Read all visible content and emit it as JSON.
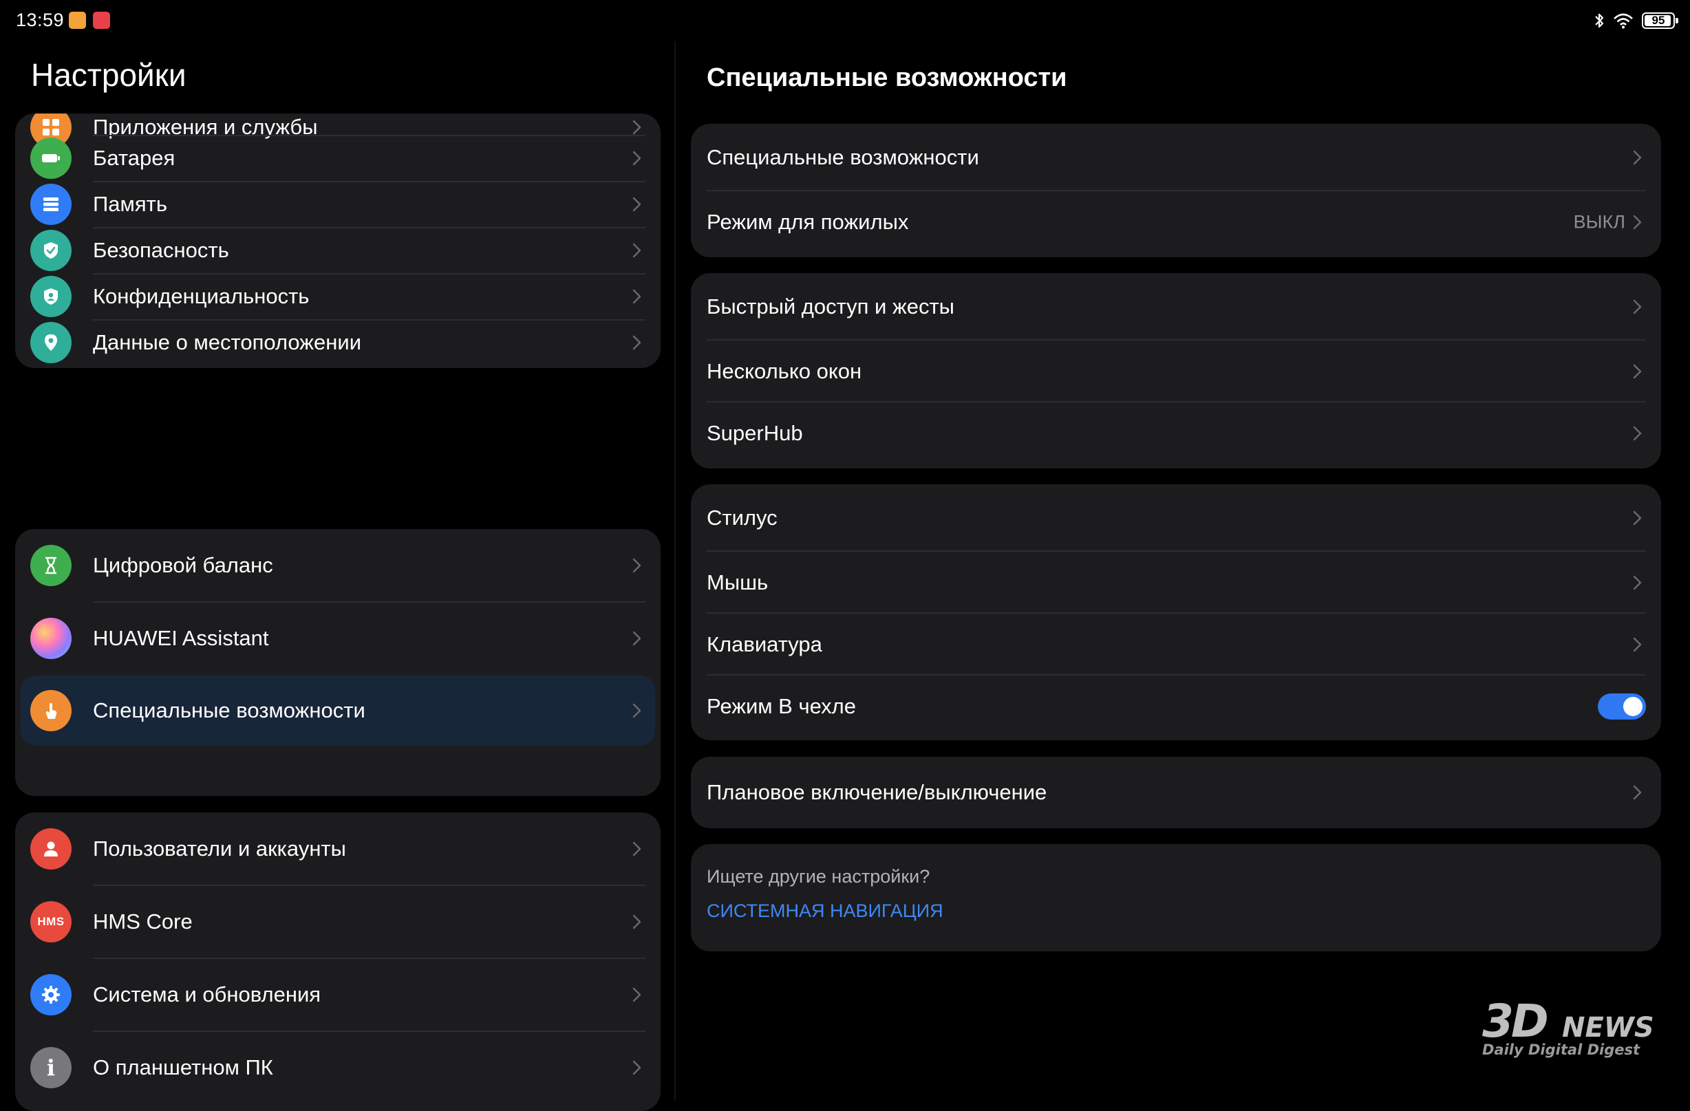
{
  "status_bar": {
    "time": "13:59",
    "battery_level": "95",
    "icons": [
      "notification-app-icon",
      "notification-app-icon",
      "bluetooth-icon",
      "wifi-icon",
      "battery-icon"
    ]
  },
  "left": {
    "title": "Настройки",
    "groups": [
      {
        "items": [
          {
            "label": "Приложения и службы",
            "icon": "apps-icon",
            "color": "#f08c34",
            "partially_visible": true
          },
          {
            "label": "Батарея",
            "icon": "battery-icon",
            "color": "#3fae4e"
          },
          {
            "label": "Память",
            "icon": "storage-icon",
            "color": "#2f7cf6"
          },
          {
            "label": "Безопасность",
            "icon": "shield-check-icon",
            "color": "#2fae9a"
          },
          {
            "label": "Конфиденциальность",
            "icon": "privacy-shield-icon",
            "color": "#2fae9a"
          },
          {
            "label": "Данные о местоположении",
            "icon": "location-pin-icon",
            "color": "#2fae9a"
          }
        ]
      },
      {
        "items": [
          {
            "label": "Цифровой баланс",
            "icon": "hourglass-icon",
            "color": "#3fae4e"
          },
          {
            "label": "HUAWEI Assistant",
            "icon": "assistant-orb-icon",
            "color": "#c46af0"
          },
          {
            "label": "Специальные возможности",
            "icon": "accessibility-hand-icon",
            "color": "#f08c34",
            "selected": true
          }
        ]
      },
      {
        "items": [
          {
            "label": "Пользователи и аккаунты",
            "icon": "user-icon",
            "color": "#e84a3d"
          },
          {
            "label": "HMS Core",
            "icon": "hms-icon",
            "color": "#e84a3d",
            "icon_text": "HMS"
          },
          {
            "label": "Система и обновления",
            "icon": "gear-icon",
            "color": "#2f7cf6"
          },
          {
            "label": "О планшетном ПК",
            "icon": "info-icon",
            "color": "#77777c",
            "icon_text": "i"
          }
        ]
      }
    ]
  },
  "right": {
    "title": "Специальные возможности",
    "groups": [
      {
        "items": [
          {
            "label": "Специальные возможности"
          },
          {
            "label": "Режим для пожилых",
            "value": "ВЫКЛ"
          }
        ]
      },
      {
        "items": [
          {
            "label": "Быстрый доступ и жесты"
          },
          {
            "label": "Несколько окон"
          },
          {
            "label": "SuperHub"
          }
        ]
      },
      {
        "items": [
          {
            "label": "Стилус"
          },
          {
            "label": "Мышь"
          },
          {
            "label": "Клавиатура"
          },
          {
            "label": "Режим В чехле",
            "toggle": true,
            "toggle_on": true
          }
        ]
      },
      {
        "items": [
          {
            "label": "Плановое включение/выключение"
          }
        ]
      }
    ],
    "hint": {
      "text": "Ищете другие настройки?",
      "link": "СИСТЕМНАЯ НАВИГАЦИЯ"
    }
  },
  "watermark": {
    "logo_main": "3D",
    "logo_news": "NEWS",
    "tagline": "Daily Digital Digest"
  },
  "colors": {
    "background": "#000000",
    "card": "#1c1c1e",
    "selected_row": "#172638",
    "accent_blue": "#2f78f2",
    "link_blue": "#3f88f5",
    "secondary_text": "#8e8e93"
  }
}
